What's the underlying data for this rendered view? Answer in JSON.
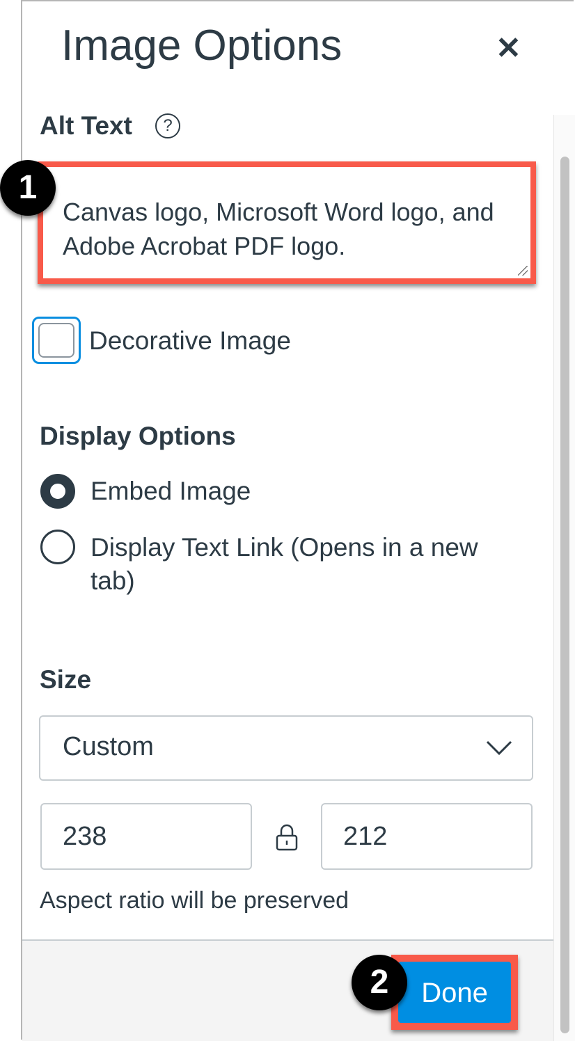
{
  "header": {
    "title": "Image Options",
    "close_icon": "close-icon"
  },
  "alt_text": {
    "label": "Alt Text",
    "help_icon": "question-circle-icon",
    "help_glyph": "?",
    "value": "Canvas logo, Microsoft Word logo, and Adobe Acrobat PDF logo."
  },
  "decorative": {
    "label": "Decorative Image",
    "checked": false
  },
  "display_options": {
    "heading": "Display Options",
    "options": [
      {
        "label": "Embed Image",
        "selected": true
      },
      {
        "label": "Display Text Link (Opens in a new tab)",
        "selected": false
      }
    ]
  },
  "size": {
    "heading": "Size",
    "selected": "Custom",
    "width": "238",
    "height": "212",
    "lock_icon": "lock-icon",
    "note": "Aspect ratio will be preserved"
  },
  "footer": {
    "done_label": "Done"
  },
  "annotations": {
    "step1": "1",
    "step2": "2",
    "highlight_color": "#f85a4a"
  },
  "colors": {
    "primary": "#008ee2",
    "text": "#2d3b45",
    "focus": "#0a8ee0"
  }
}
